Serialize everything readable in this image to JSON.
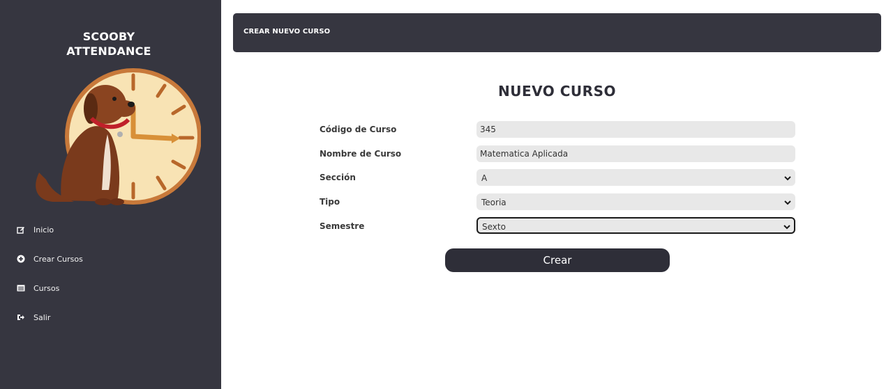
{
  "brand": {
    "line1": "SCOOBY",
    "line2": "ATTENDANCE"
  },
  "sidebar": {
    "items": [
      {
        "label": "Inicio",
        "icon": "edit-icon"
      },
      {
        "label": "Crear Cursos",
        "icon": "plus-circle-icon"
      },
      {
        "label": "Cursos",
        "icon": "list-icon"
      },
      {
        "label": "Salir",
        "icon": "sign-out-icon"
      }
    ]
  },
  "header": {
    "title": "CREAR NUEVO CURSO"
  },
  "form": {
    "title": "NUEVO CURSO",
    "fields": [
      {
        "label": "Código de Curso",
        "value": "345"
      },
      {
        "label": "Nombre de Curso",
        "value": "Matematica Aplicada"
      },
      {
        "label": "Sección",
        "value": "A"
      },
      {
        "label": "Tipo",
        "value": "Teoria"
      },
      {
        "label": "Semestre",
        "value": "Sexto"
      }
    ],
    "submit_label": "Crear"
  },
  "colors": {
    "sidebar": "#363640",
    "accent_dark": "#2e2e38",
    "field_bg": "#e8e8e8"
  }
}
